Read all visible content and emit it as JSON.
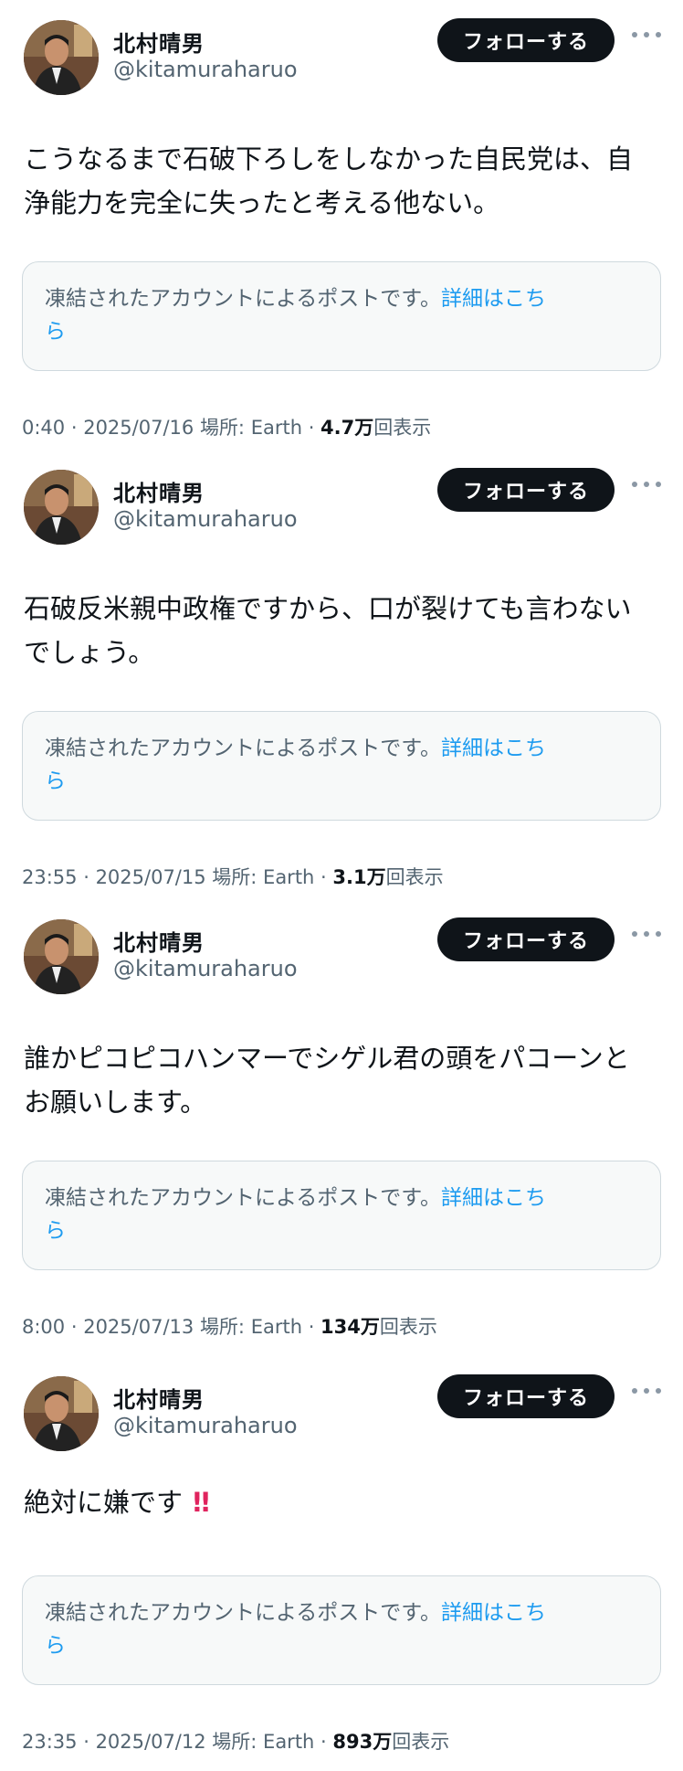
{
  "posts": [
    {
      "author": {
        "name": "北村晴男",
        "handle": "@kitamuraharuo"
      },
      "follow_label": "フォローする",
      "text_lines": [
        "こうなるまで石破下ろしをしなかった自民党は、自",
        "浄能力を完全に失ったと考える他ない。"
      ],
      "notice": {
        "text": "凍結されたアカウントによるポストです。",
        "link": "詳細はこち",
        "link_wrap": "ら"
      },
      "meta": {
        "time": "0:40",
        "date": "2025/07/16",
        "location": "場所: Earth",
        "views": "4.7万",
        "views_suffix": "回表示"
      }
    },
    {
      "author": {
        "name": "北村晴男",
        "handle": "@kitamuraharuo"
      },
      "follow_label": "フォローする",
      "text_lines": [
        "石破反米親中政権ですから、口が裂けても言わない",
        "でしょう。"
      ],
      "notice": {
        "text": "凍結されたアカウントによるポストです。",
        "link": "詳細はこち",
        "link_wrap": "ら"
      },
      "meta": {
        "time": "23:55",
        "date": "2025/07/15",
        "location": "場所: Earth",
        "views": "3.1万",
        "views_suffix": "回表示"
      }
    },
    {
      "author": {
        "name": "北村晴男",
        "handle": "@kitamuraharuo"
      },
      "follow_label": "フォローする",
      "text_lines": [
        "誰かピコピコハンマーでシゲル君の頭をパコーンと",
        "お願いします。"
      ],
      "notice": {
        "text": "凍結されたアカウントによるポストです。",
        "link": "詳細はこち",
        "link_wrap": "ら"
      },
      "meta": {
        "time": "8:00",
        "date": "2025/07/13",
        "location": "場所: Earth",
        "views": "134万",
        "views_suffix": "回表示"
      }
    },
    {
      "author": {
        "name": "北村晴男",
        "handle": "@kitamuraharuo"
      },
      "follow_label": "フォローする",
      "text_lines": [
        "絶対に嫌です",
        ""
      ],
      "emoji": "double-exclamation-icon",
      "notice": {
        "text": "凍結されたアカウントによるポストです。",
        "link": "詳細はこち",
        "link_wrap": "ら"
      },
      "meta": {
        "time": "23:35",
        "date": "2025/07/12",
        "location": "場所: Earth",
        "views": "893万",
        "views_suffix": "回表示"
      }
    }
  ],
  "colors": {
    "link": "#1d9bf0",
    "secondary": "#536471",
    "button": "#0f1419",
    "notice_bg": "#f7f9f9"
  }
}
